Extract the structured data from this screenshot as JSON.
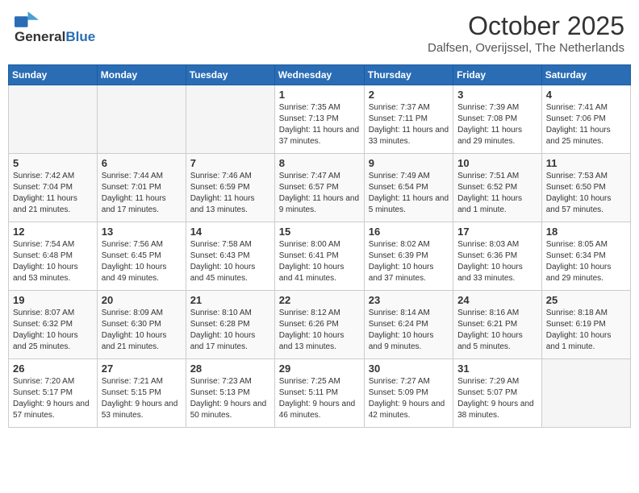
{
  "header": {
    "logo_general": "General",
    "logo_blue": "Blue",
    "month": "October 2025",
    "location": "Dalfsen, Overijssel, The Netherlands"
  },
  "days_of_week": [
    "Sunday",
    "Monday",
    "Tuesday",
    "Wednesday",
    "Thursday",
    "Friday",
    "Saturday"
  ],
  "weeks": [
    [
      {
        "day": "",
        "text": ""
      },
      {
        "day": "",
        "text": ""
      },
      {
        "day": "",
        "text": ""
      },
      {
        "day": "1",
        "text": "Sunrise: 7:35 AM\nSunset: 7:13 PM\nDaylight: 11 hours and 37 minutes."
      },
      {
        "day": "2",
        "text": "Sunrise: 7:37 AM\nSunset: 7:11 PM\nDaylight: 11 hours and 33 minutes."
      },
      {
        "day": "3",
        "text": "Sunrise: 7:39 AM\nSunset: 7:08 PM\nDaylight: 11 hours and 29 minutes."
      },
      {
        "day": "4",
        "text": "Sunrise: 7:41 AM\nSunset: 7:06 PM\nDaylight: 11 hours and 25 minutes."
      }
    ],
    [
      {
        "day": "5",
        "text": "Sunrise: 7:42 AM\nSunset: 7:04 PM\nDaylight: 11 hours and 21 minutes."
      },
      {
        "day": "6",
        "text": "Sunrise: 7:44 AM\nSunset: 7:01 PM\nDaylight: 11 hours and 17 minutes."
      },
      {
        "day": "7",
        "text": "Sunrise: 7:46 AM\nSunset: 6:59 PM\nDaylight: 11 hours and 13 minutes."
      },
      {
        "day": "8",
        "text": "Sunrise: 7:47 AM\nSunset: 6:57 PM\nDaylight: 11 hours and 9 minutes."
      },
      {
        "day": "9",
        "text": "Sunrise: 7:49 AM\nSunset: 6:54 PM\nDaylight: 11 hours and 5 minutes."
      },
      {
        "day": "10",
        "text": "Sunrise: 7:51 AM\nSunset: 6:52 PM\nDaylight: 11 hours and 1 minute."
      },
      {
        "day": "11",
        "text": "Sunrise: 7:53 AM\nSunset: 6:50 PM\nDaylight: 10 hours and 57 minutes."
      }
    ],
    [
      {
        "day": "12",
        "text": "Sunrise: 7:54 AM\nSunset: 6:48 PM\nDaylight: 10 hours and 53 minutes."
      },
      {
        "day": "13",
        "text": "Sunrise: 7:56 AM\nSunset: 6:45 PM\nDaylight: 10 hours and 49 minutes."
      },
      {
        "day": "14",
        "text": "Sunrise: 7:58 AM\nSunset: 6:43 PM\nDaylight: 10 hours and 45 minutes."
      },
      {
        "day": "15",
        "text": "Sunrise: 8:00 AM\nSunset: 6:41 PM\nDaylight: 10 hours and 41 minutes."
      },
      {
        "day": "16",
        "text": "Sunrise: 8:02 AM\nSunset: 6:39 PM\nDaylight: 10 hours and 37 minutes."
      },
      {
        "day": "17",
        "text": "Sunrise: 8:03 AM\nSunset: 6:36 PM\nDaylight: 10 hours and 33 minutes."
      },
      {
        "day": "18",
        "text": "Sunrise: 8:05 AM\nSunset: 6:34 PM\nDaylight: 10 hours and 29 minutes."
      }
    ],
    [
      {
        "day": "19",
        "text": "Sunrise: 8:07 AM\nSunset: 6:32 PM\nDaylight: 10 hours and 25 minutes."
      },
      {
        "day": "20",
        "text": "Sunrise: 8:09 AM\nSunset: 6:30 PM\nDaylight: 10 hours and 21 minutes."
      },
      {
        "day": "21",
        "text": "Sunrise: 8:10 AM\nSunset: 6:28 PM\nDaylight: 10 hours and 17 minutes."
      },
      {
        "day": "22",
        "text": "Sunrise: 8:12 AM\nSunset: 6:26 PM\nDaylight: 10 hours and 13 minutes."
      },
      {
        "day": "23",
        "text": "Sunrise: 8:14 AM\nSunset: 6:24 PM\nDaylight: 10 hours and 9 minutes."
      },
      {
        "day": "24",
        "text": "Sunrise: 8:16 AM\nSunset: 6:21 PM\nDaylight: 10 hours and 5 minutes."
      },
      {
        "day": "25",
        "text": "Sunrise: 8:18 AM\nSunset: 6:19 PM\nDaylight: 10 hours and 1 minute."
      }
    ],
    [
      {
        "day": "26",
        "text": "Sunrise: 7:20 AM\nSunset: 5:17 PM\nDaylight: 9 hours and 57 minutes."
      },
      {
        "day": "27",
        "text": "Sunrise: 7:21 AM\nSunset: 5:15 PM\nDaylight: 9 hours and 53 minutes."
      },
      {
        "day": "28",
        "text": "Sunrise: 7:23 AM\nSunset: 5:13 PM\nDaylight: 9 hours and 50 minutes."
      },
      {
        "day": "29",
        "text": "Sunrise: 7:25 AM\nSunset: 5:11 PM\nDaylight: 9 hours and 46 minutes."
      },
      {
        "day": "30",
        "text": "Sunrise: 7:27 AM\nSunset: 5:09 PM\nDaylight: 9 hours and 42 minutes."
      },
      {
        "day": "31",
        "text": "Sunrise: 7:29 AM\nSunset: 5:07 PM\nDaylight: 9 hours and 38 minutes."
      },
      {
        "day": "",
        "text": ""
      }
    ]
  ]
}
